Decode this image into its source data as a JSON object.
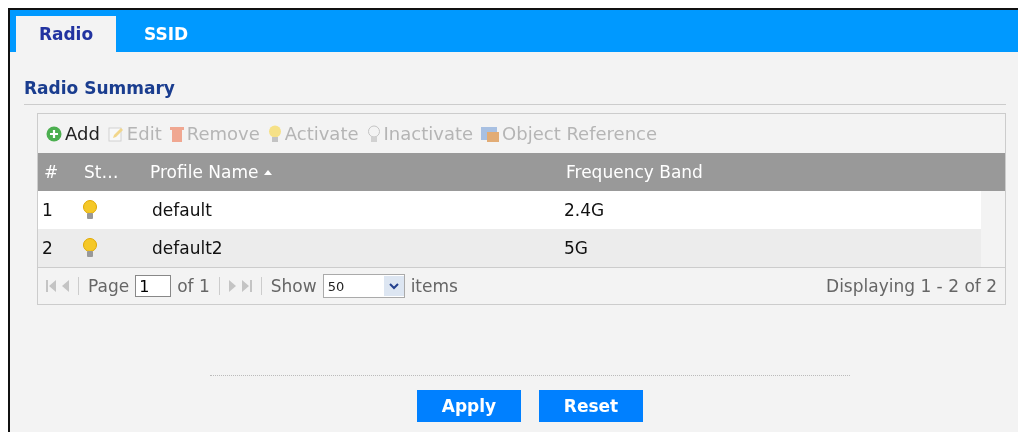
{
  "tabs": [
    {
      "label": "Radio",
      "selected": true
    },
    {
      "label": "SSID",
      "selected": false
    }
  ],
  "section_title": "Radio Summary",
  "toolbar": [
    {
      "label": "Add",
      "kind": "add",
      "disabled": false
    },
    {
      "label": "Edit",
      "kind": "edit",
      "disabled": true
    },
    {
      "label": "Remove",
      "kind": "remove",
      "disabled": true
    },
    {
      "label": "Activate",
      "kind": "activate",
      "disabled": true
    },
    {
      "label": "Inactivate",
      "kind": "inactivate",
      "disabled": true
    },
    {
      "label": "Object Reference",
      "kind": "reference",
      "disabled": true
    }
  ],
  "table": {
    "columns": [
      {
        "label": "#",
        "sorted": false
      },
      {
        "label": "St…",
        "sorted": false
      },
      {
        "label": "Profile Name",
        "sorted": true
      },
      {
        "label": "Frequency Band",
        "sorted": false
      }
    ],
    "rows": [
      {
        "index": "1",
        "active": true,
        "name": "default",
        "band": "2.4G"
      },
      {
        "index": "2",
        "active": true,
        "name": "default2",
        "band": "5G"
      }
    ]
  },
  "pager": {
    "page_label": "Page",
    "page": "1",
    "of": "of 1",
    "show_label": "Show",
    "show": "50",
    "items_label": "items",
    "displaying": "Displaying 1 - 2 of 2"
  },
  "buttons": [
    "Apply",
    "Reset"
  ]
}
